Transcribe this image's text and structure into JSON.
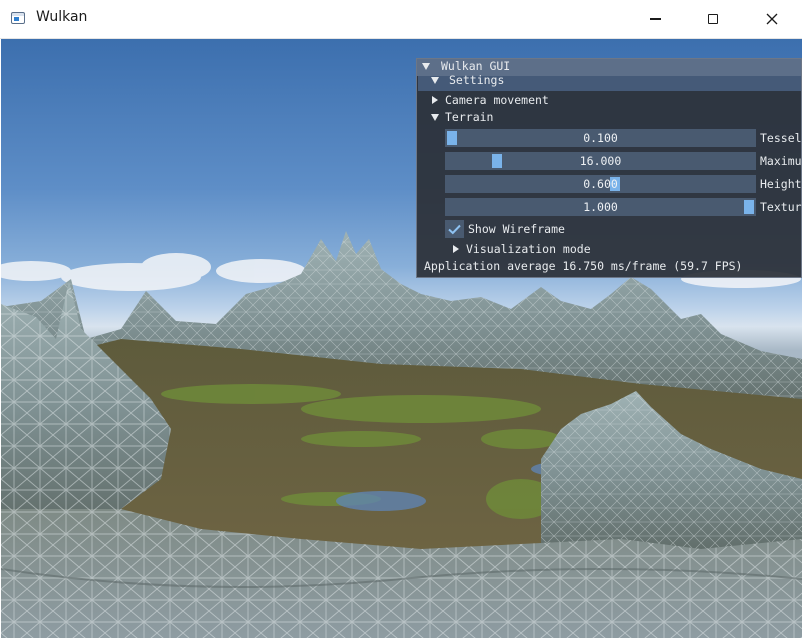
{
  "window": {
    "title": "Wulkan",
    "icon": "app-window-icon",
    "controls": [
      "minimize-icon",
      "maximize-icon",
      "close-icon"
    ]
  },
  "gui": {
    "title": "Wulkan GUI",
    "settings_header": "Settings",
    "camera_movement": "Camera movement",
    "terrain": "Terrain",
    "sliders": [
      {
        "value_text": "0.100",
        "label": "Tessel",
        "fill_fraction": 0.0
      },
      {
        "value_text": "16.000",
        "label": "Maximu",
        "fill_fraction": 0.15
      },
      {
        "value_text": "0.600",
        "label": "Height",
        "fill_fraction": 0.55
      },
      {
        "value_text": "1.000",
        "label": "Textur",
        "fill_fraction": 1.0
      }
    ],
    "wireframe": {
      "label": "Show Wireframe",
      "checked": true
    },
    "visualization_mode": "Visualization mode",
    "stats": "Application average 16.750 ms/frame (59.7 FPS)"
  },
  "colors": {
    "gui_background": "#2c3038",
    "gui_titlebar": "#5d6f89",
    "slider_frame": "#495a70",
    "slider_grab": "#7ab3ea",
    "text": "#e8ebee"
  }
}
